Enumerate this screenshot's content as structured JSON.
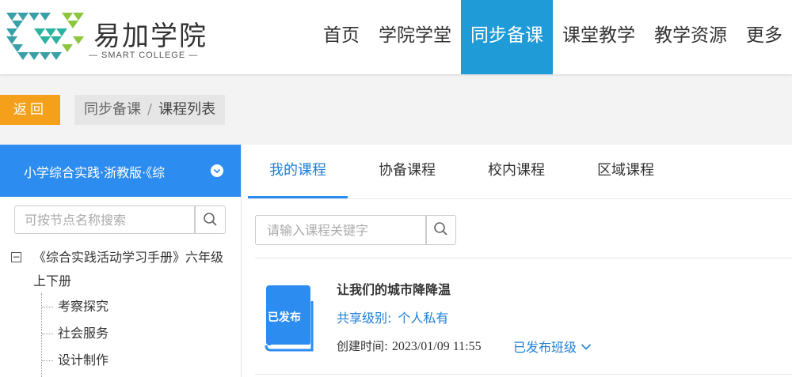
{
  "header": {
    "logo_title": "易加学院",
    "logo_subtitle": "— SMART COLLEGE —",
    "nav": [
      {
        "label": "首页"
      },
      {
        "label": "学院学堂"
      },
      {
        "label": "同步备课",
        "active": true
      },
      {
        "label": "课堂教学"
      },
      {
        "label": "教学资源"
      },
      {
        "label": "更多"
      }
    ],
    "active_color": "#1f9bd7"
  },
  "toolbar": {
    "back_label": "返回",
    "breadcrumb": [
      "同步备课",
      "课程列表"
    ],
    "breadcrumb_sep": "/"
  },
  "sidebar": {
    "selector_text": "小学综合实践·浙教版·《综",
    "search_placeholder": "可按节点名称搜索",
    "tree": {
      "root_toggle": "−",
      "root_label": "《综合实践活动学习手册》六年级上下册",
      "children": [
        "考察探究",
        "社会服务",
        "设计制作"
      ]
    },
    "header_color": "#2d8cf0"
  },
  "main": {
    "tabs": [
      {
        "label": "我的课程",
        "active": true
      },
      {
        "label": "协备课程"
      },
      {
        "label": "校内课程"
      },
      {
        "label": "区域课程"
      }
    ],
    "search_placeholder": "请输入课程关键字",
    "course": {
      "badge": "已发布",
      "title": "让我们的城市降降温",
      "share_label": "共享级别:",
      "share_value": "个人私有",
      "created_label": "创建时间:",
      "created_value": "2023/01/09 11:55",
      "published_label": "已发布班级"
    }
  },
  "colors": {
    "back_button": "#f5a01a",
    "accent": "#2d8cf0",
    "link": "#1f7fd6"
  }
}
